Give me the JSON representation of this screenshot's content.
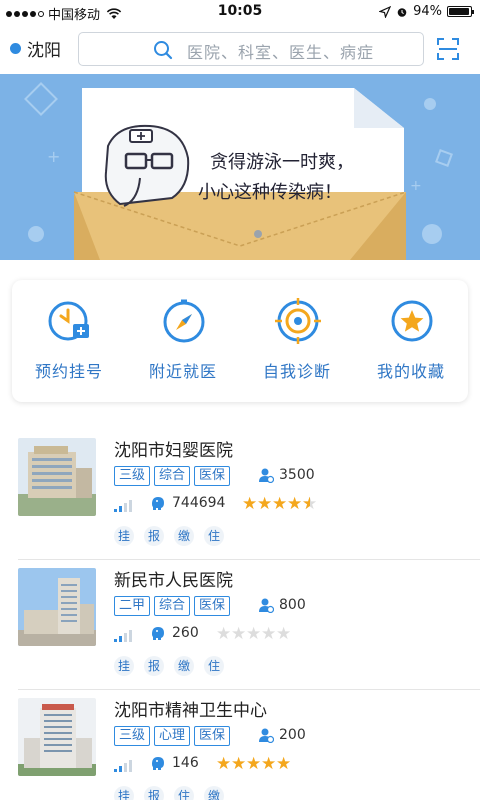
{
  "status_bar": {
    "carrier": "中国移动",
    "time": "10:05",
    "battery": "94%",
    "battery_level": 0.94
  },
  "header": {
    "city": "沈阳",
    "search_placeholder": "医院、科室、医生、病症"
  },
  "banner": {
    "line1": "贪得游泳一时爽，",
    "line2": "小心这种传染病！"
  },
  "quick_menu": [
    {
      "label": "预约挂号",
      "icon": "clock-medical-icon"
    },
    {
      "label": "附近就医",
      "icon": "compass-icon"
    },
    {
      "label": "自我诊断",
      "icon": "target-icon"
    },
    {
      "label": "我的收藏",
      "icon": "star-icon"
    }
  ],
  "hospitals": [
    {
      "name": "沈阳市妇婴医院",
      "tags": [
        "三级",
        "综合",
        "医保"
      ],
      "count": "3500",
      "views": "744694",
      "rating": 4.5,
      "services": [
        "挂",
        "报",
        "缴",
        "住"
      ]
    },
    {
      "name": "新民市人民医院",
      "tags": [
        "二甲",
        "综合",
        "医保"
      ],
      "count": "800",
      "views": "260",
      "rating": 0,
      "services": [
        "挂",
        "报",
        "缴",
        "住"
      ]
    },
    {
      "name": "沈阳市精神卫生中心",
      "tags": [
        "三级",
        "心理",
        "医保"
      ],
      "count": "200",
      "views": "146",
      "rating": 5,
      "services": [
        "挂",
        "报",
        "住",
        "缴"
      ]
    }
  ],
  "colors": {
    "accent": "#2f8be0",
    "banner_bg": "#7cb2e6",
    "star": "#f4a71d",
    "envelope": "#e8c27a"
  }
}
